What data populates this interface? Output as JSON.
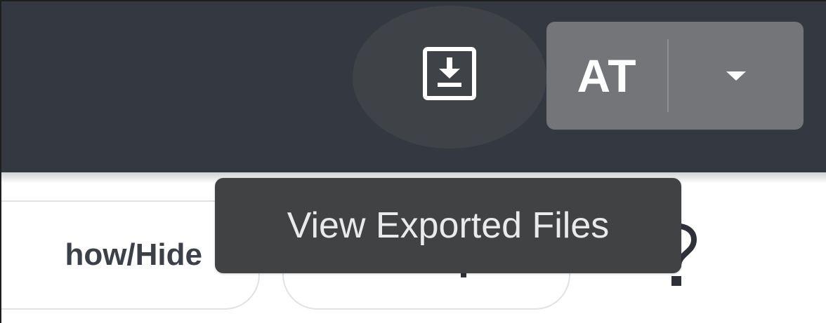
{
  "header": {
    "export_button": {
      "icon": "download-icon",
      "tooltip": "View Exported Files"
    },
    "user_menu": {
      "initials": "AT",
      "caret_icon": "caret-down-icon"
    }
  },
  "toolbar": {
    "show_hide_label": "how/Hide",
    "help_icon": "question-mark-icon"
  },
  "colors": {
    "header_bg": "#343840",
    "user_button_bg": "#737578",
    "tooltip_bg": "#404244"
  }
}
